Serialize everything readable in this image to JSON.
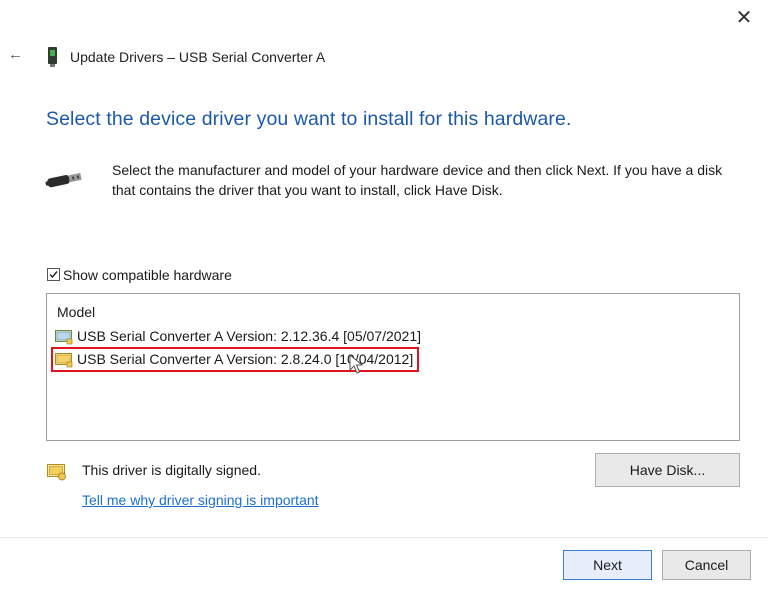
{
  "window": {
    "close_glyph": "✕",
    "back_glyph": "←",
    "title": "Update Drivers – USB Serial Converter A"
  },
  "heading": "Select the device driver you want to install for this hardware.",
  "instructions": "Select the manufacturer and model of your hardware device and then click Next. If you have a disk that contains the driver that you want to install, click Have Disk.",
  "compatible": {
    "label": "Show compatible hardware",
    "checked": true
  },
  "model_list": {
    "header": "Model",
    "items": [
      {
        "label": "USB Serial Converter A Version: 2.12.36.4 [05/07/2021]"
      },
      {
        "label": "USB Serial Converter A Version: 2.8.24.0 [10/04/2012]",
        "highlighted": true
      }
    ]
  },
  "signing": {
    "status": "This driver is digitally signed.",
    "link": "Tell me why driver signing is important"
  },
  "buttons": {
    "have_disk": "Have Disk...",
    "next": "Next",
    "cancel": "Cancel"
  },
  "colors": {
    "heading": "#1c5aa6",
    "link": "#1c6fd1",
    "highlight_border": "#e0141e",
    "next_border": "#3a7bd5"
  },
  "icons": {
    "close": "close-icon",
    "back": "back-arrow-icon",
    "device": "usb-device-icon",
    "connector": "usb-connector-icon",
    "driver": "driver-package-icon",
    "cursor": "mouse-cursor-icon"
  }
}
